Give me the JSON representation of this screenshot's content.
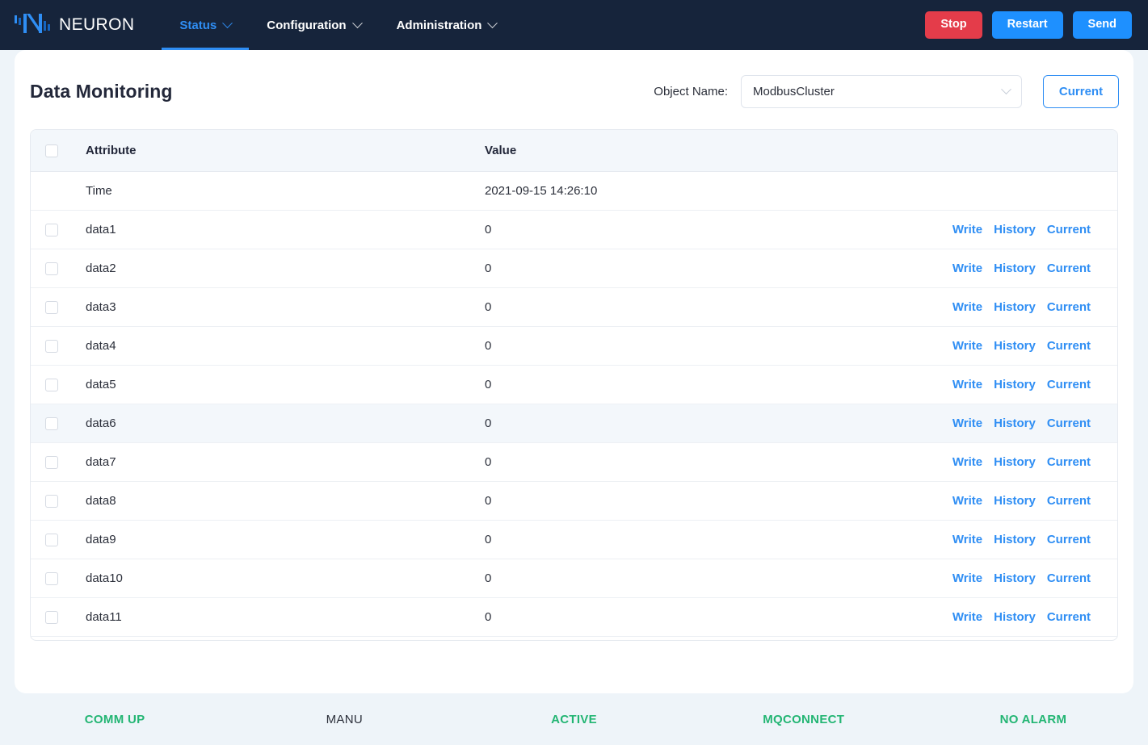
{
  "navbar": {
    "brand": {
      "logo_icon": "neuron-logo-icon",
      "name": "NEURON"
    },
    "items": [
      {
        "label": "Status",
        "icon": "chevron-down-icon",
        "active": true
      },
      {
        "label": "Configuration",
        "icon": "chevron-down-icon",
        "active": false
      },
      {
        "label": "Administration",
        "icon": "chevron-down-icon",
        "active": false
      }
    ],
    "actions": [
      {
        "label": "Stop",
        "color": "#e43c4a"
      },
      {
        "label": "Restart",
        "color": "#1e90ff"
      },
      {
        "label": "Send",
        "color": "#1e90ff"
      }
    ]
  },
  "page": {
    "title": "Data Monitoring",
    "object_name_label": "Object Name:",
    "object_select": {
      "value": "ModbusCluster",
      "icon": "chevron-down-icon"
    },
    "current_button": {
      "label": "Current",
      "color": "#2f8ef4"
    }
  },
  "table": {
    "columns": [
      "",
      "Attribute",
      "Value",
      ""
    ],
    "row_actions": [
      "Write",
      "History",
      "Current"
    ],
    "rows": [
      {
        "checkbox": false,
        "attribute": "Time",
        "value": "2021-09-15 14:26:10",
        "actions": false,
        "highlight": false
      },
      {
        "checkbox": true,
        "attribute": "data1",
        "value": "0",
        "actions": true,
        "highlight": false
      },
      {
        "checkbox": true,
        "attribute": "data2",
        "value": "0",
        "actions": true,
        "highlight": false
      },
      {
        "checkbox": true,
        "attribute": "data3",
        "value": "0",
        "actions": true,
        "highlight": false
      },
      {
        "checkbox": true,
        "attribute": "data4",
        "value": "0",
        "actions": true,
        "highlight": false
      },
      {
        "checkbox": true,
        "attribute": "data5",
        "value": "0",
        "actions": true,
        "highlight": false
      },
      {
        "checkbox": true,
        "attribute": "data6",
        "value": "0",
        "actions": true,
        "highlight": true
      },
      {
        "checkbox": true,
        "attribute": "data7",
        "value": "0",
        "actions": true,
        "highlight": false
      },
      {
        "checkbox": true,
        "attribute": "data8",
        "value": "0",
        "actions": true,
        "highlight": false
      },
      {
        "checkbox": true,
        "attribute": "data9",
        "value": "0",
        "actions": true,
        "highlight": false
      },
      {
        "checkbox": true,
        "attribute": "data10",
        "value": "0",
        "actions": true,
        "highlight": false
      },
      {
        "checkbox": true,
        "attribute": "data11",
        "value": "0",
        "actions": true,
        "highlight": false
      },
      {
        "checkbox": true,
        "attribute": "",
        "value": "",
        "actions": false,
        "highlight": false
      }
    ]
  },
  "status_bar": {
    "items": [
      {
        "label": "COMM UP",
        "color": "#22b573"
      },
      {
        "label": "MANU",
        "color": "#2b2f3a"
      },
      {
        "label": "ACTIVE",
        "color": "#22b573"
      },
      {
        "label": "MQCONNECT",
        "color": "#22b573"
      },
      {
        "label": "NO ALARM",
        "color": "#22b573"
      }
    ]
  }
}
